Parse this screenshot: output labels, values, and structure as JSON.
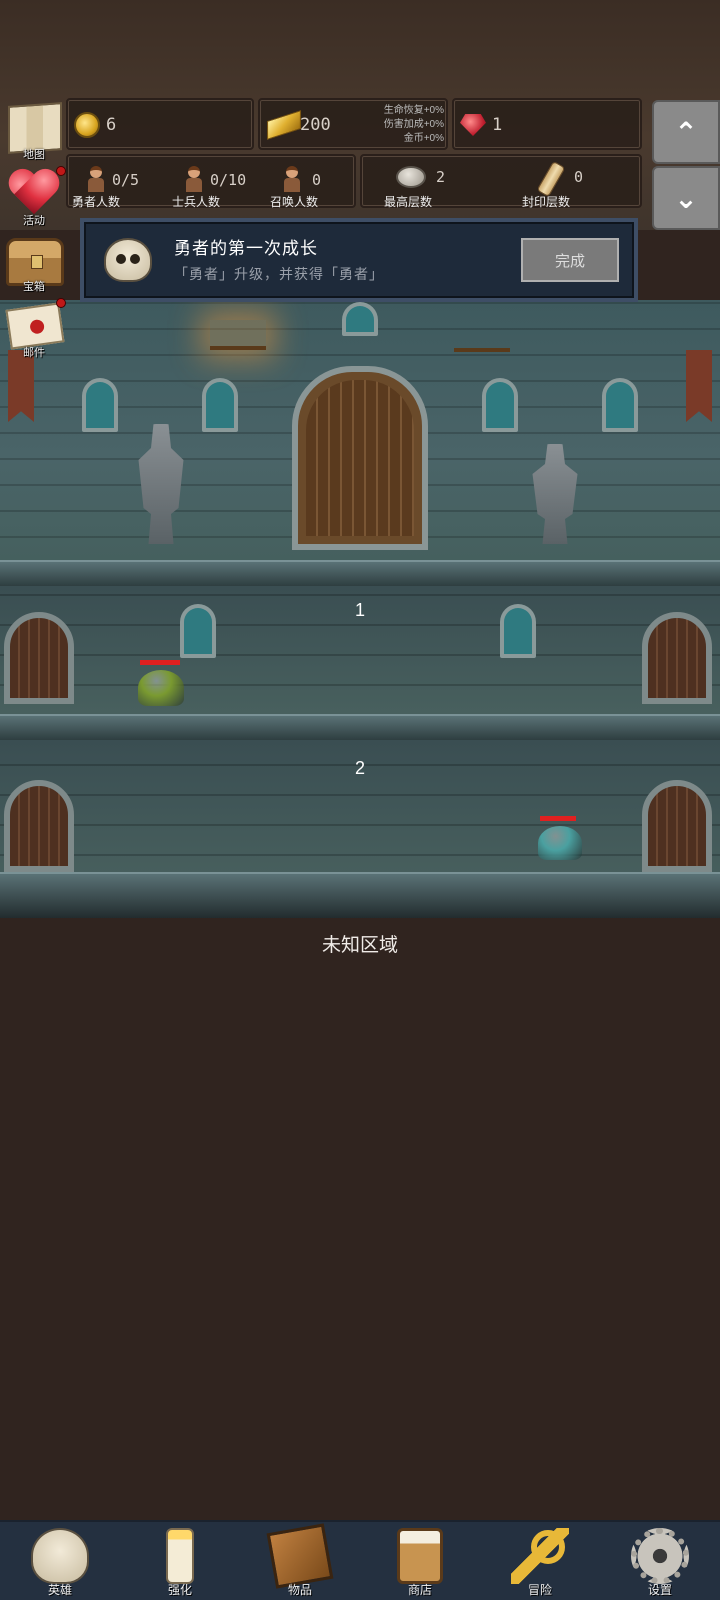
{
  "resources": {
    "coins": "6",
    "gold": "200",
    "gold_bonus": [
      "生命恢复+0%",
      "伤害加成+0%",
      "金币+0%"
    ],
    "gems": "1"
  },
  "stats": {
    "heroes": {
      "value": "0/5",
      "label": "勇者人数"
    },
    "soldiers": {
      "value": "0/10",
      "label": "士兵人数"
    },
    "summons": {
      "value": "0",
      "label": "召唤人数"
    },
    "max_floor": {
      "value": "2",
      "label": "最高层数"
    },
    "sealed_floor": {
      "value": "0",
      "label": "封印层数"
    }
  },
  "sidebar": {
    "items": [
      {
        "label": "地图",
        "icon": "map-icon"
      },
      {
        "label": "活动",
        "icon": "heart-icon",
        "badge": true
      },
      {
        "label": "宝箱",
        "icon": "chest-icon"
      },
      {
        "label": "邮件",
        "icon": "letter-icon",
        "badge": true
      }
    ]
  },
  "scroll_buttons": {
    "up": "⌃",
    "down": "⌄"
  },
  "quest": {
    "title": "勇者的第一次成长",
    "description": "「勇者」升级，并获得「勇者」",
    "button": "完成"
  },
  "levels": [
    {
      "number": "1"
    },
    {
      "number": "2"
    }
  ],
  "unknown_area": "未知区域",
  "enemies": [
    {
      "name": "green-slime",
      "hp": 1.0,
      "color": "#7a9a30"
    },
    {
      "name": "teal-slime",
      "hp": 0.9,
      "color": "#4aa0a0"
    }
  ],
  "nav": {
    "items": [
      {
        "label": "英雄",
        "icon": "skull-icon"
      },
      {
        "label": "强化",
        "icon": "candle-icon"
      },
      {
        "label": "物品",
        "icon": "book-icon"
      },
      {
        "label": "商店",
        "icon": "mug-icon"
      },
      {
        "label": "冒险",
        "icon": "key-icon"
      },
      {
        "label": "设置",
        "icon": "gear-icon"
      }
    ]
  }
}
